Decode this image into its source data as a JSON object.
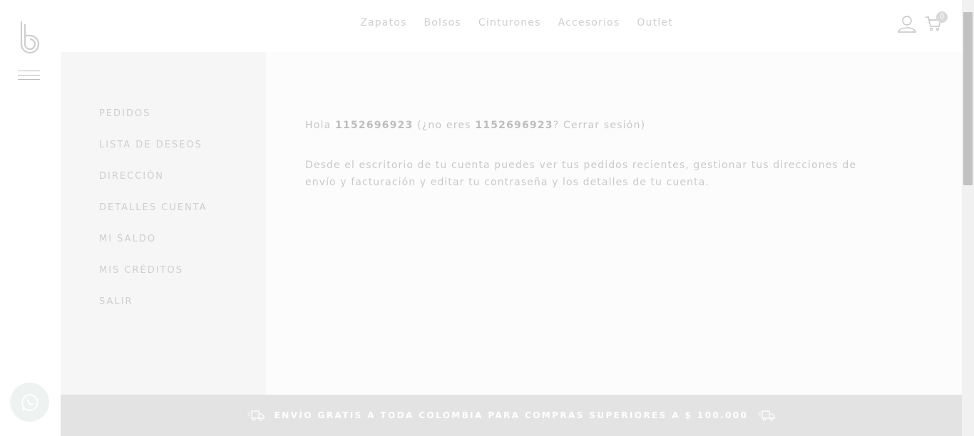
{
  "nav": {
    "items": [
      "Zapatos",
      "Bolsos",
      "Cinturones",
      "Accesorios",
      "Outlet"
    ],
    "cart_count": "0"
  },
  "sidebar": {
    "items": [
      "PEDIDOS",
      "LISTA DE DESEOS",
      "DIRECCIÓN",
      "DETALLES CUENTA",
      "MI SALDO",
      "MIS CRÉDITOS",
      "SALIR"
    ]
  },
  "account": {
    "hello": "Hola",
    "username": "1152696923",
    "not_you_prefix": "(¿no eres",
    "username_again": "1152696923",
    "question_mark": "?",
    "logout_link": "Cerrar sesión",
    "close_paren": ")",
    "description": "Desde el escritorio de tu cuenta puedes ver tus pedidos recientes, gestionar tus direcciones de envío y facturación y editar tu contraseña y los detalles de tu cuenta."
  },
  "banner": {
    "text": "ENVÍO GRATIS A TODA COLOMBIA PARA COMPRAS SUPERIORES A $ 100.000"
  },
  "icons": {
    "logo": "brand-b-logo",
    "menu": "hamburger-icon",
    "user": "user-icon",
    "cart": "cart-icon",
    "chat": "whatsapp-icon",
    "shipping": "truck-icon"
  },
  "colors": {
    "sidebar_bg": "#f6f6f6",
    "banner_bg": "#e3e3e3",
    "text_muted": "#cfcfcf"
  }
}
